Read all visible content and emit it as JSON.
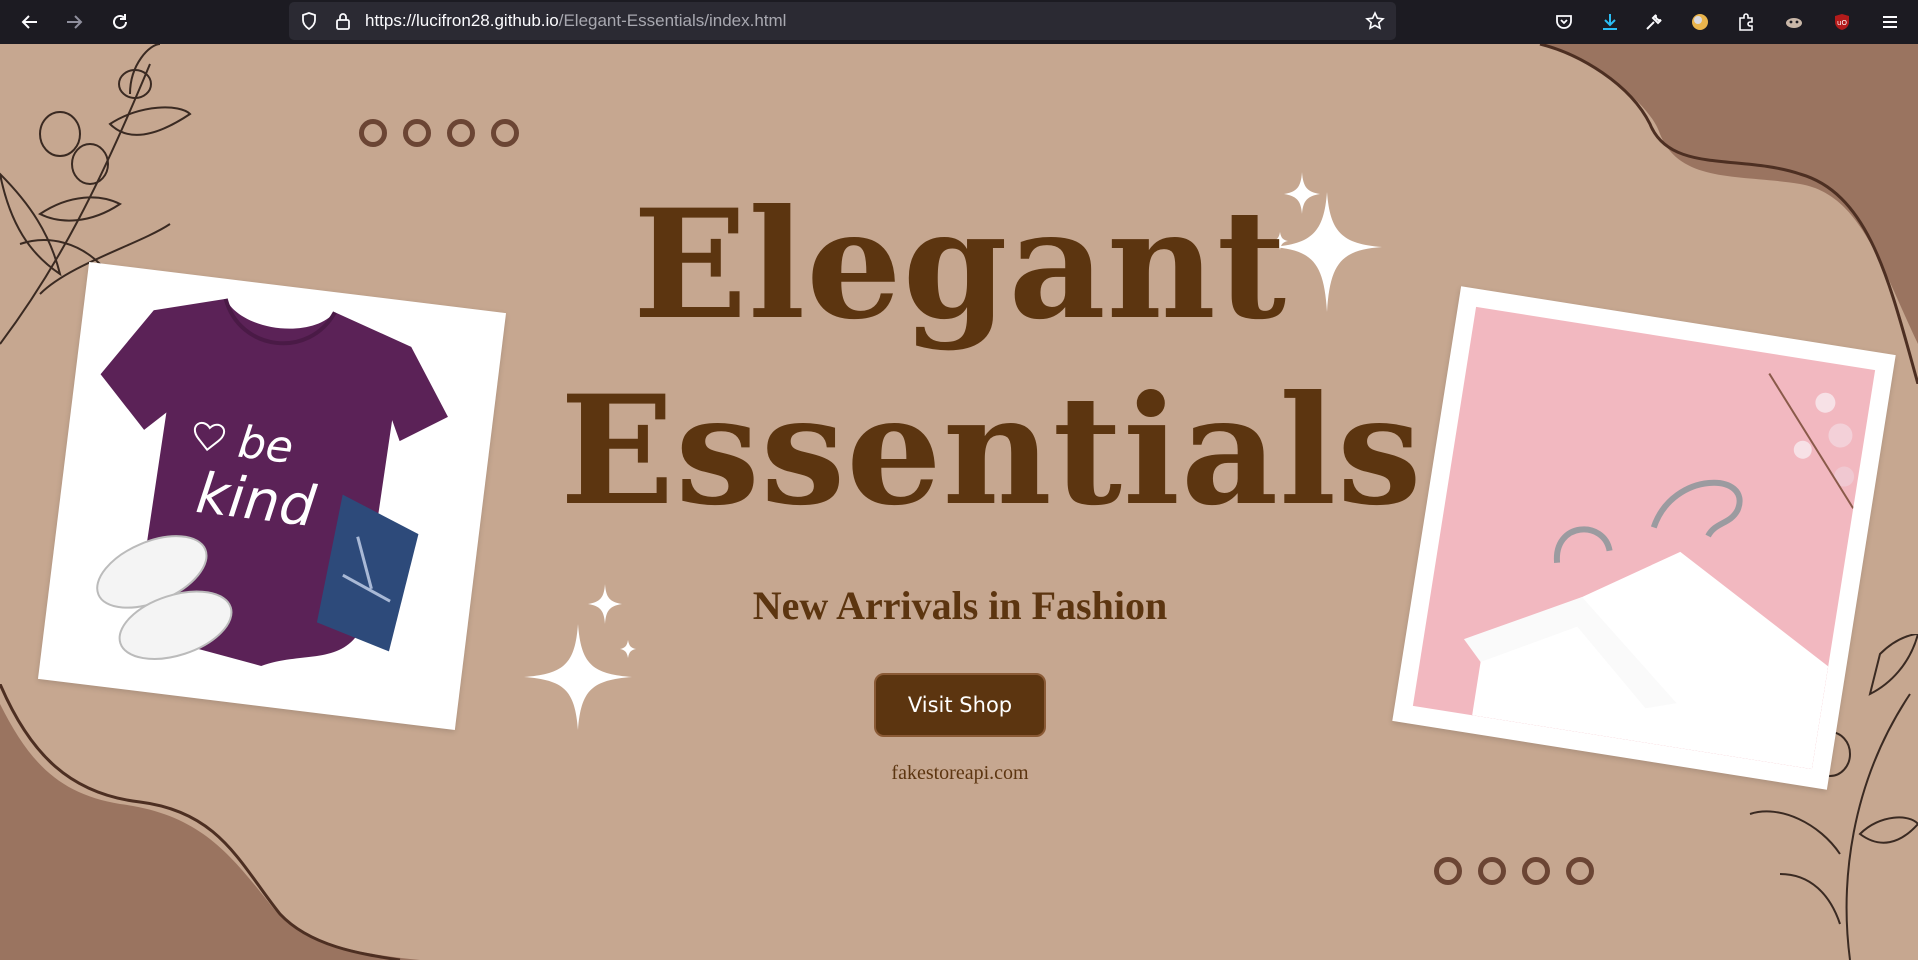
{
  "browser": {
    "url_host": "https://lucifron28.github.io",
    "url_path": "/Elegant-Essentials/index.html"
  },
  "hero": {
    "title_line1": "Elegant",
    "title_line2": "Essentials",
    "subtitle": "New Arrivals in Fashion",
    "cta_label": "Visit Shop",
    "footnote": "fakestoreapi.com"
  },
  "shirt_print": {
    "line1": "be",
    "line2": "kind"
  },
  "colors": {
    "page_bg": "#c6a790",
    "accent_brown": "#5c3510",
    "blob_brown": "#9a7460",
    "toolbar_bg": "#1c1b22"
  }
}
